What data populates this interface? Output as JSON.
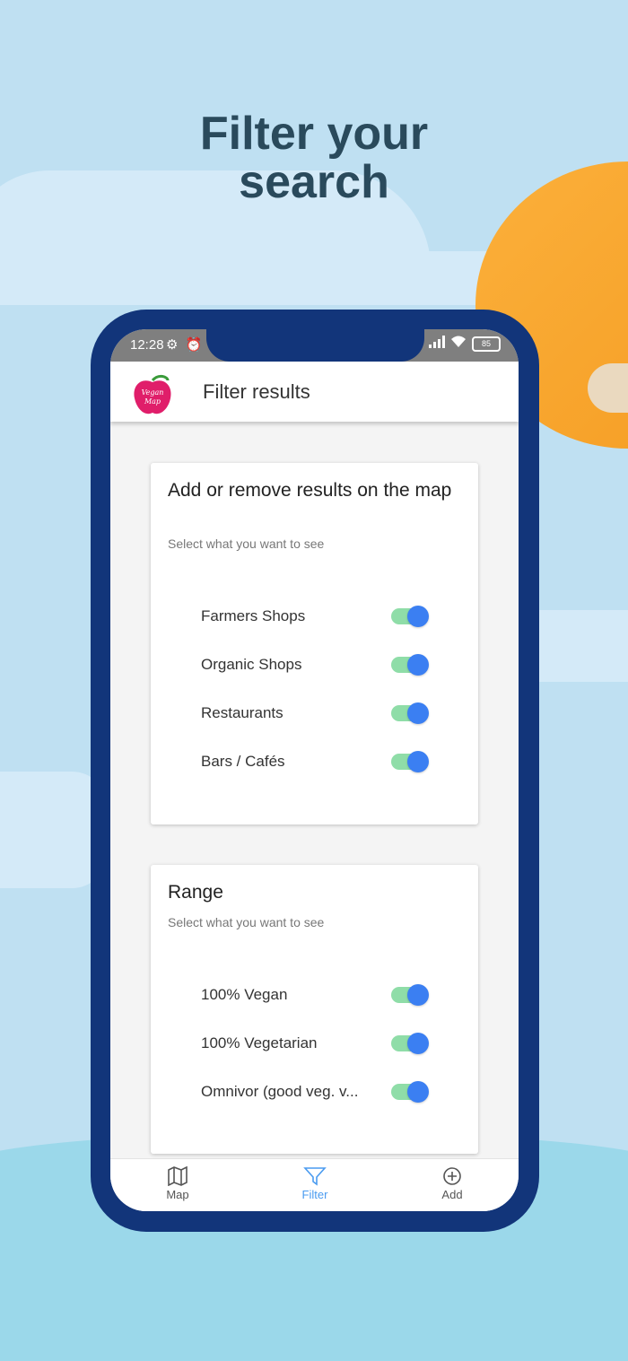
{
  "headline": {
    "line1": "Filter your",
    "line2": "search"
  },
  "status_bar": {
    "time": "12:28",
    "battery": "85"
  },
  "app_bar": {
    "title": "Filter results",
    "logo_text": "Vegan Map"
  },
  "cards": [
    {
      "title": "Add or remove results on the map",
      "subtitle": "Select what you want to see",
      "toggles": [
        {
          "label": "Farmers Shops",
          "on": true
        },
        {
          "label": "Organic Shops",
          "on": true
        },
        {
          "label": "Restaurants",
          "on": true
        },
        {
          "label": "Bars / Cafés",
          "on": true
        }
      ]
    },
    {
      "title": "Range",
      "subtitle": "Select what you want to see",
      "toggles": [
        {
          "label": "100% Vegan",
          "on": true
        },
        {
          "label": "100% Vegetarian",
          "on": true
        },
        {
          "label": "Omnivor (good veg. v...",
          "on": true
        }
      ]
    }
  ],
  "bottom_nav": [
    {
      "label": "Map",
      "icon": "map-icon",
      "active": false
    },
    {
      "label": "Filter",
      "icon": "filter-icon",
      "active": true
    },
    {
      "label": "Add",
      "icon": "plus-circle-icon",
      "active": false
    }
  ],
  "colors": {
    "phone_frame": "#12357a",
    "toggle_track": "#8fdda8",
    "toggle_knob": "#3b7ff2",
    "nav_active": "#4a9bf0",
    "sun": "#f59c22"
  }
}
